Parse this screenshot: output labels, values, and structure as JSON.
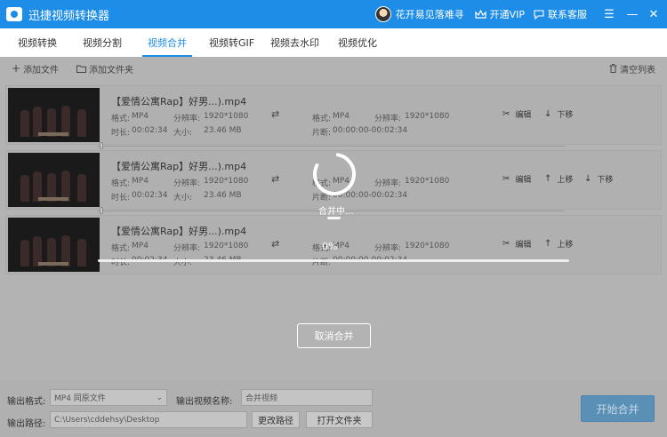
{
  "app": {
    "title": "迅捷视频转换器",
    "username": "花开易见落难寻",
    "vip_label": "开通VIP",
    "support_label": "联系客服",
    "accent_color": "#1e8de8"
  },
  "tabs": [
    {
      "label": "视频转换"
    },
    {
      "label": "视频分割"
    },
    {
      "label": "视频合并"
    },
    {
      "label": "视频转GIF"
    },
    {
      "label": "视频去水印"
    },
    {
      "label": "视频优化"
    }
  ],
  "active_tab": "视频合并",
  "toolbar": {
    "add_file": "添加文件",
    "add_folder": "添加文件夹",
    "clear_list": "清空列表"
  },
  "files": [
    {
      "name": "【爱情公寓Rap】好男...).mp4",
      "format_label": "格式:",
      "format": "MP4",
      "resolution_label": "分辨率:",
      "resolution": "1920*1080",
      "duration_label": "时长:",
      "duration": "00:02:34",
      "size_label": "大小:",
      "size": "23.46 MB",
      "out_format_label": "格式:",
      "out_format": "MP4",
      "out_resolution_label": "分辨率:",
      "out_resolution": "1920*1080",
      "segment_label": "片断:",
      "segment": "00:00:00-00:02:34",
      "edit": "编辑",
      "up": "",
      "down": "下移"
    },
    {
      "name": "【爱情公寓Rap】好男...).mp4",
      "format_label": "格式:",
      "format": "MP4",
      "resolution_label": "分辨率:",
      "resolution": "1920*1080",
      "duration_label": "时长:",
      "duration": "00:02:34",
      "size_label": "大小:",
      "size": "23.46 MB",
      "out_format_label": "格式:",
      "out_format": "MP4",
      "out_resolution_label": "分辨率:",
      "out_resolution": "1920*1080",
      "segment_label": "片断:",
      "segment": "00:00:00-00:02:34",
      "edit": "编辑",
      "up": "上移",
      "down": "下移"
    },
    {
      "name": "【爱情公寓Rap】好男...).mp4",
      "format_label": "格式:",
      "format": "MP4",
      "resolution_label": "分辨率:",
      "resolution": "1920*1080",
      "duration_label": "时长:",
      "duration": "00:02:34",
      "size_label": "大小:",
      "size": "23.46 MB",
      "out_format_label": "格式:",
      "out_format": "MP4",
      "out_resolution_label": "分辨率:",
      "out_resolution": "1920*1080",
      "segment_label": "片断:",
      "segment": "00:00:00-00:02:34",
      "edit": "编辑",
      "up": "上移",
      "down": ""
    }
  ],
  "progress": {
    "status_text": "合并中...",
    "percent_text": "0%",
    "percent_value": 0,
    "cancel_label": "取消合并"
  },
  "bottom": {
    "output_format_label": "输出格式:",
    "output_format_value": "MP4  同原文件",
    "output_name_label": "输出视频名称:",
    "output_name_value": "合并视频",
    "output_path_label": "输出路径:",
    "output_path_value": "C:\\Users\\cddehsy\\Desktop",
    "change_path": "更改路径",
    "open_folder": "打开文件夹",
    "start_merge": "开始合并"
  }
}
